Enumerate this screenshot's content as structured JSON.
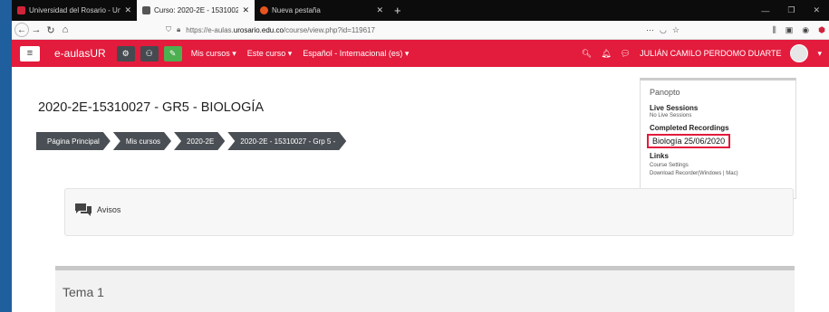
{
  "browser": {
    "tabs": [
      {
        "title": "Universidad del Rosario - Unive",
        "favicon_color": "#d0233a"
      },
      {
        "title": "Curso: 2020-2E - 15310027 - G",
        "favicon_color": "#555555"
      },
      {
        "title": "Nueva pestaña",
        "favicon_color": "#e8541e"
      }
    ],
    "url_prefix": "https://e-aulas.",
    "url_domain": "urosario.edu.co",
    "url_path": "/course/view.php?id=119617"
  },
  "header": {
    "brand": "e-aulasUR",
    "menu": [
      "Mis cursos ▾",
      "Este curso ▾",
      "Español - Internacional (es) ▾"
    ],
    "user": "JULIÁN CAMILO PERDOMO DUARTE",
    "colors": {
      "primary": "#e31b3c",
      "green": "#4caf50",
      "dark": "#444a50"
    }
  },
  "course": {
    "title": "2020-2E-15310027 - GR5 - BIOLOGÍA",
    "breadcrumbs": [
      "Página Principal",
      "Mis cursos",
      "2020-2E",
      "2020-2E - 15310027 - Grp 5 -"
    ]
  },
  "panopto": {
    "title": "Panopto",
    "live_heading": "Live Sessions",
    "live_text": "No Live Sessions",
    "completed_heading": "Completed Recordings",
    "recording": "Biología 25/06/2020",
    "links_heading": "Links",
    "link1": "Course Settings",
    "link2": "Download Recorder(Windows | Mac)"
  },
  "sections": {
    "avisos": "Avisos",
    "tema1": "Tema 1"
  }
}
